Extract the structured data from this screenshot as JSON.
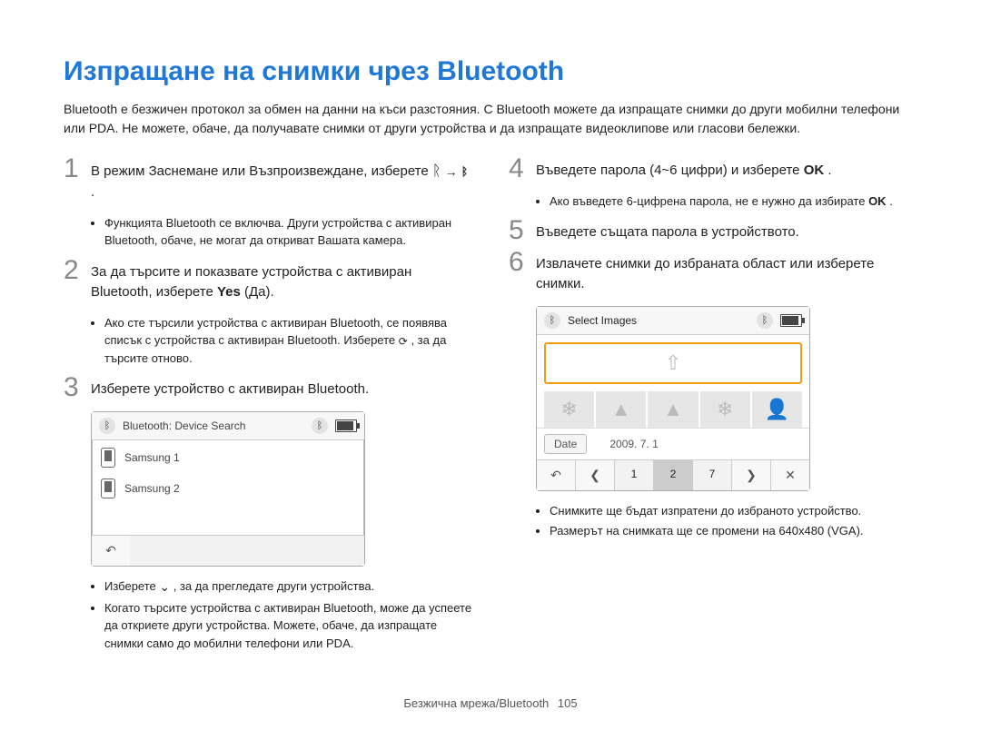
{
  "title": "Изпращане на снимки чрез Bluetooth",
  "intro": "Bluetooth е безжичен протокол за обмен на данни на къси разстояния. С Bluetooth можете да изпращате снимки до други мобилни телефони или PDA. Не можете, обаче, да получавате снимки от други устройства и да изпращате видеоклипове или гласови бележки.",
  "left": {
    "step1": {
      "num": "1",
      "text_a": "В режим Заснемане или Възпроизвеждане, изберете ",
      "text_b": " → ",
      "text_c": ".",
      "bullets": [
        "Функцията Bluetooth се включва. Други устройства с активиран Bluetooth, обаче, не могат да откриват Вашата камера."
      ]
    },
    "step2": {
      "num": "2",
      "text_a": "За да търсите и показвате устройства с активиран Bluetooth, изберете ",
      "bold": "Yes",
      "text_b": " (Да).",
      "bullets_a": "Ако сте търсили устройства с активиран Bluetooth, се появява списък с устройства с активиран Bluetooth. Изберете ",
      "bullets_b": ", за да търсите отново."
    },
    "step3": {
      "num": "3",
      "text": "Изберете устройство с активиран Bluetooth.",
      "shot": {
        "title": "Bluetooth: Device Search",
        "dev1": "Samsung 1",
        "dev2": "Samsung 2"
      },
      "bullets_a": "Изберете ",
      "bullets_a2": ", за да прегледате други устройства.",
      "bullets_b": "Когато търсите устройства с активиран Bluetooth, може да успеете да откриете други устройства. Можете, обаче, да изпращате снимки само до мобилни телефони или PDA."
    }
  },
  "right": {
    "step4": {
      "num": "4",
      "text_a": "Въведете парола (4~6 цифри) и изберете ",
      "bold": "OK",
      "text_b": ".",
      "bullets_a": "Ако въведете 6-цифрена парола, не е нужно да избирате ",
      "bullets_bold": "OK",
      "bullets_b": "."
    },
    "step5": {
      "num": "5",
      "text": "Въведете същата парола в устройството."
    },
    "step6": {
      "num": "6",
      "text": "Извлачете снимки до избраната област или изберете снимки.",
      "shot": {
        "title": "Select Images",
        "date_btn": "Date",
        "date_val": "2009. 7. 1",
        "p1": "1",
        "p2": "2",
        "p7": "7"
      },
      "bullets": [
        "Снимките ще бъдат изпратени до избраното устройство.",
        "Размерът на снимката ще се промени на 640x480 (VGA)."
      ]
    }
  },
  "footer": {
    "section": "Безжична мрежа/Bluetooth",
    "page": "105"
  }
}
